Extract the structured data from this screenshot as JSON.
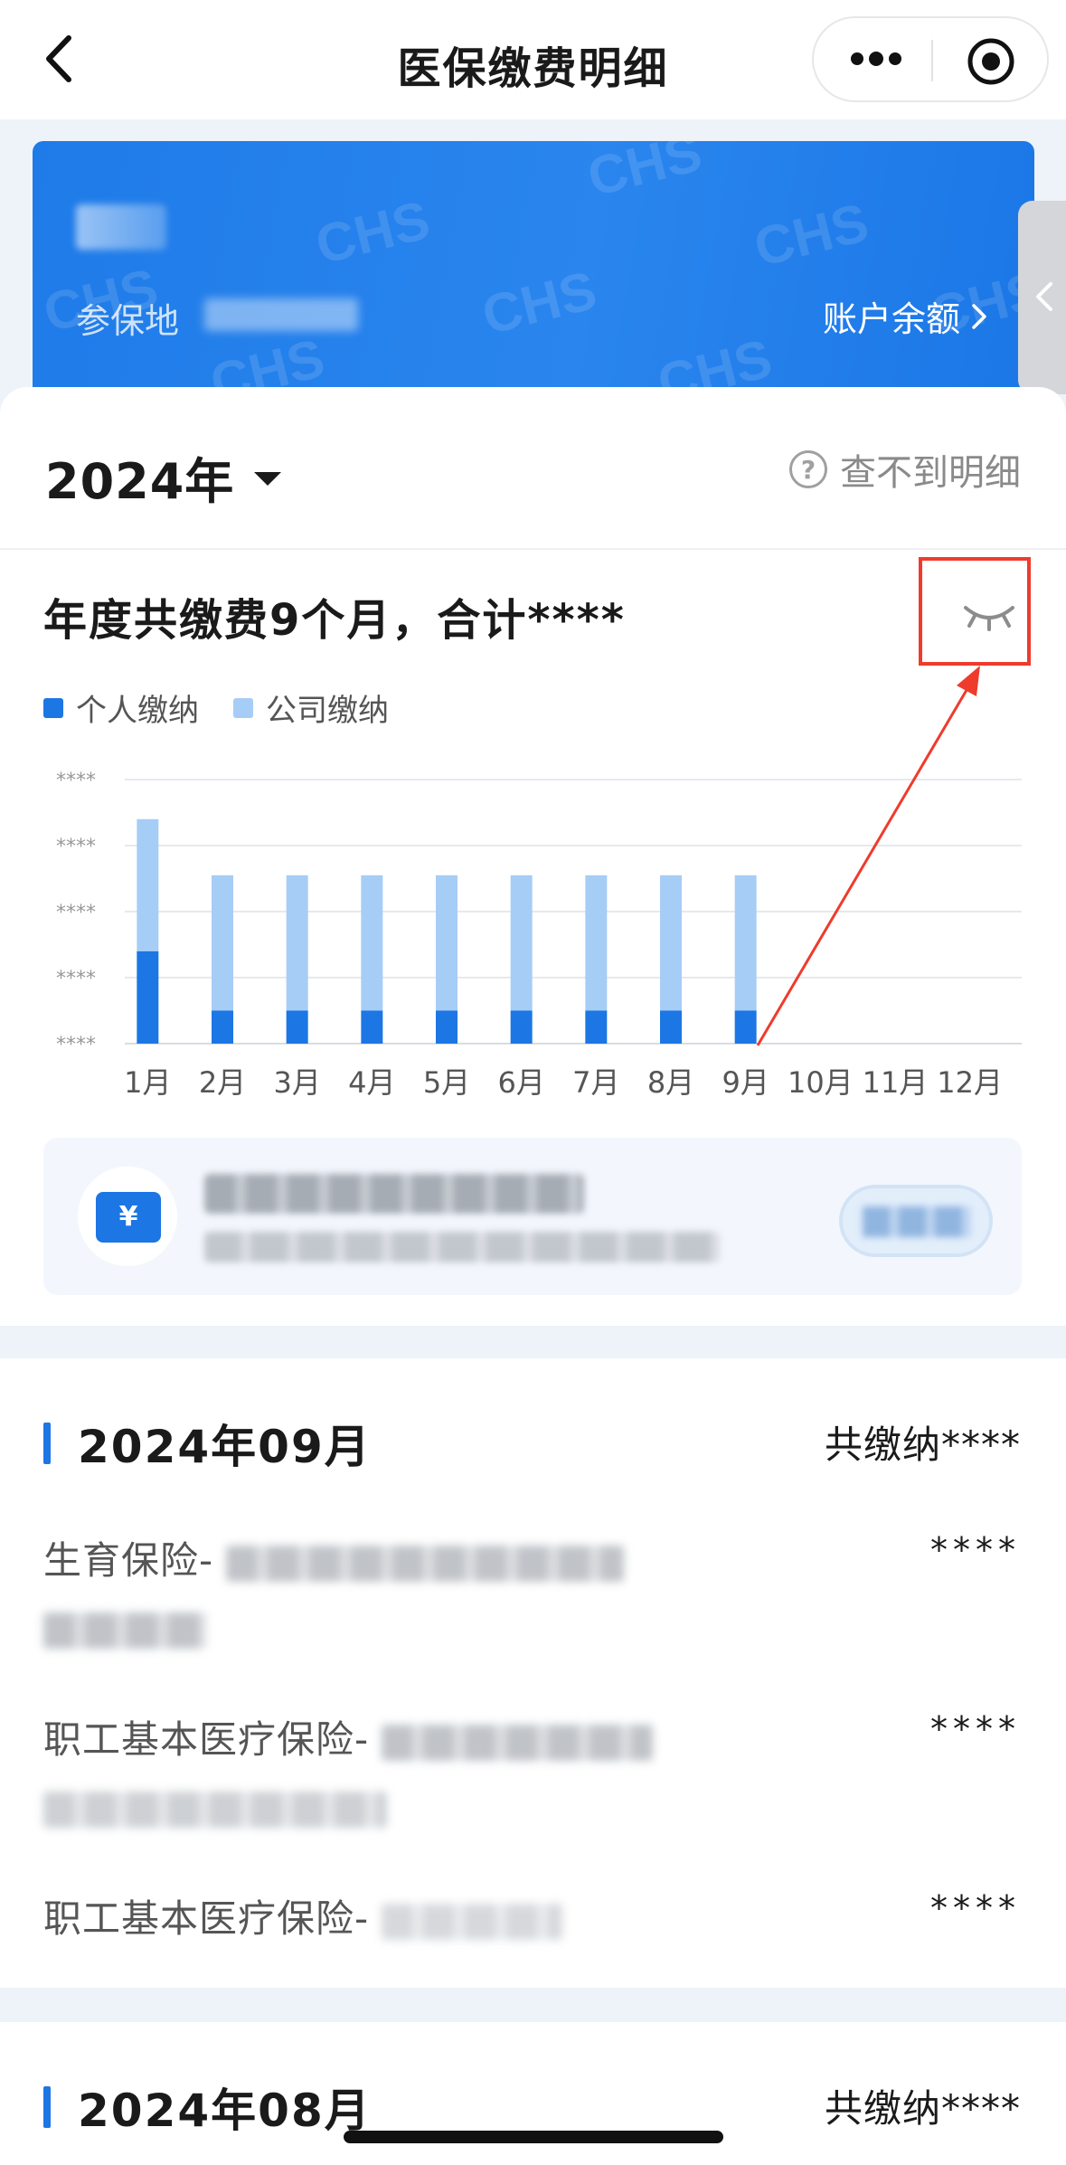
{
  "navbar": {
    "title": "医保缴费明细"
  },
  "card": {
    "location_label": "参保地",
    "balance_link": "账户余额"
  },
  "year_selector": {
    "year": "2024年"
  },
  "missing_detail": "查不到明细",
  "summary": {
    "text": "年度共缴费9个月，合计****"
  },
  "legend": [
    {
      "label": "个人缴纳",
      "color": "#1c76e4"
    },
    {
      "label": "公司缴纳",
      "color": "#a6cdf6"
    }
  ],
  "chart_data": {
    "type": "bar",
    "stacked": true,
    "categories": [
      "1月",
      "2月",
      "3月",
      "4月",
      "5月",
      "6月",
      "7月",
      "8月",
      "9月",
      "10月",
      "11月",
      "12月"
    ],
    "y_tick_labels": [
      "****",
      "****",
      "****",
      "****",
      "****"
    ],
    "ylim": [
      0,
      4
    ],
    "series": [
      {
        "name": "个人缴纳",
        "color": "#1c76e4",
        "values": [
          1.4,
          0.5,
          0.5,
          0.5,
          0.5,
          0.5,
          0.5,
          0.5,
          0.5,
          0,
          0,
          0
        ]
      },
      {
        "name": "公司缴纳",
        "color": "#a6cdf6",
        "values": [
          2.0,
          2.05,
          2.05,
          2.05,
          2.05,
          2.05,
          2.05,
          2.05,
          2.05,
          0,
          0,
          0
        ]
      }
    ],
    "grid": true
  },
  "months": [
    {
      "title": "2024年09月",
      "total": "共缴纳****",
      "items": [
        {
          "name": "生育保险-",
          "amount": "****"
        },
        {
          "name": "职工基本医疗保险-",
          "amount": "****"
        },
        {
          "name": "职工基本医疗保险-",
          "amount": "****"
        }
      ]
    },
    {
      "title": "2024年08月",
      "total": "共缴纳****"
    }
  ]
}
